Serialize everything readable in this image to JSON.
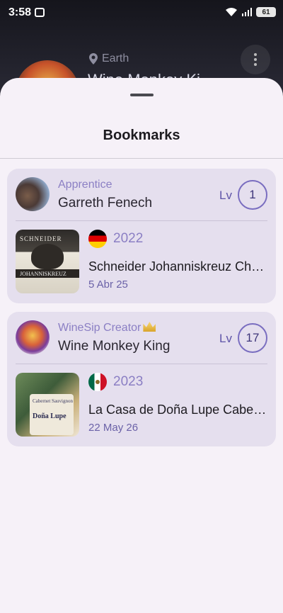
{
  "status_bar": {
    "time": "3:58",
    "battery": "61"
  },
  "background": {
    "location": "Earth",
    "name": "Wine Monkey Ki"
  },
  "sheet": {
    "title": "Bookmarks"
  },
  "bookmarks": [
    {
      "user": {
        "rank": "Apprentice",
        "name": "Garreth Fenech",
        "level_prefix": "Lv",
        "level": "1",
        "has_crown": false
      },
      "wine": {
        "flag": "germany-flag-icon",
        "vintage": "2022",
        "name": "Schneider Johanniskreuz Chardonnay",
        "date": "5 Abr 25",
        "label_top": "SCHNEIDER",
        "label_band": "JOHANNISKREUZ"
      }
    },
    {
      "user": {
        "rank": "WineSip Creator",
        "name": "Wine Monkey King",
        "level_prefix": "Lv",
        "level": "17",
        "has_crown": true
      },
      "wine": {
        "flag": "mexico-flag-icon",
        "vintage": "2023",
        "name": "La Casa de Doña Lupe Cabernet Sauvignon",
        "date": "22 May 26",
        "label_top": "Cabernet Sauvignon",
        "label_main": "Doña Lupe"
      }
    }
  ],
  "colors": {
    "sheet_bg": "#f6f1f8",
    "card_bg": "#e5dfee",
    "accent": "#8b7fc4"
  }
}
